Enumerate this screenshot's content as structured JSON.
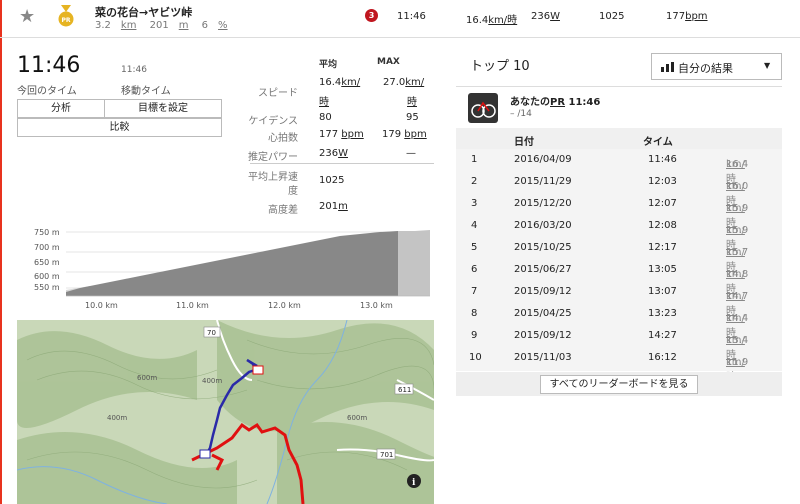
{
  "segment": {
    "name": "菜の花台→ヤビツ峠",
    "distance": "3.2",
    "distance_unit": "km",
    "elevation_gain": "201",
    "elevation_unit": "m",
    "grade": "6",
    "grade_unit": "%"
  },
  "header_stats": {
    "rank": "3",
    "time": "11:46",
    "speed": "16.4",
    "speed_unit": "km/時",
    "power": "236",
    "power_unit": "W",
    "vam": "1025",
    "heartrate": "177",
    "heartrate_unit": "bpm"
  },
  "effort": {
    "time": "11:46",
    "time_label": "今回のタイム",
    "moving_time": "11:46",
    "moving_time_label": "移動タイム"
  },
  "buttons": {
    "analysis": "分析",
    "set_goal": "目標を設定",
    "compare": "比較"
  },
  "stats": {
    "avg_header": "平均",
    "max_header": "MAX",
    "speed_label": "スピード",
    "speed_avg": "16.4",
    "speed_max": "27.0",
    "speed_unit_a": "km/",
    "speed_unit_b": "時",
    "cadence_label": "ケイデンス",
    "cadence_avg": "80",
    "cadence_max": "95",
    "hr_label": "心拍数",
    "hr_avg": "177",
    "hr_max": "179",
    "hr_unit": "bpm",
    "power_label": "推定パワー",
    "power_avg": "236",
    "power_unit": "W",
    "power_max": "—",
    "vam_label_a": "平均上昇速",
    "vam_label_b": "度",
    "vam_value": "1025",
    "elev_label": "高度差",
    "elev_value": "201",
    "elev_unit": "m"
  },
  "elevation_profile": {
    "y_ticks": [
      "750 m",
      "700 m",
      "650 m",
      "600 m",
      "550 m"
    ],
    "x_ticks": [
      "10.0 km",
      "11.0 km",
      "12.0 km",
      "13.0 km"
    ]
  },
  "map": {
    "road_labels": [
      "70",
      "611",
      "701"
    ],
    "contour_labels": [
      "400m",
      "600m",
      "400m",
      "600m"
    ],
    "info_icon": "i"
  },
  "leaderboard": {
    "title": "トップ 10",
    "filter_label": "自分の結果",
    "pr_title_a": "あなたの",
    "pr_title_pr": "PR",
    "pr_time": "11:46",
    "pr_rank": "– /14",
    "col_date": "日付",
    "col_time": "タイム",
    "speed_unit": "km/時",
    "rows": [
      {
        "rank": "1",
        "date": "2016/04/09",
        "time": "11:46",
        "speed": "16.4"
      },
      {
        "rank": "2",
        "date": "2015/11/29",
        "time": "12:03",
        "speed": "16.0"
      },
      {
        "rank": "3",
        "date": "2015/12/20",
        "time": "12:07",
        "speed": "15.9"
      },
      {
        "rank": "4",
        "date": "2016/03/20",
        "time": "12:08",
        "speed": "15.9"
      },
      {
        "rank": "5",
        "date": "2015/10/25",
        "time": "12:17",
        "speed": "15.7"
      },
      {
        "rank": "6",
        "date": "2015/06/27",
        "time": "13:05",
        "speed": "14.8"
      },
      {
        "rank": "7",
        "date": "2015/09/12",
        "time": "13:07",
        "speed": "14.7"
      },
      {
        "rank": "8",
        "date": "2015/04/25",
        "time": "13:23",
        "speed": "14.4"
      },
      {
        "rank": "9",
        "date": "2015/09/12",
        "time": "14:27",
        "speed": "13.4"
      },
      {
        "rank": "10",
        "date": "2015/11/03",
        "time": "16:12",
        "speed": "11.9"
      }
    ],
    "see_all": "すべてのリーダーボードを見る"
  },
  "colors": {
    "accent": "#e8321e",
    "rank_badge": "#c0161f",
    "route_blue": "#2a2aa8",
    "route_red": "#e01010"
  }
}
